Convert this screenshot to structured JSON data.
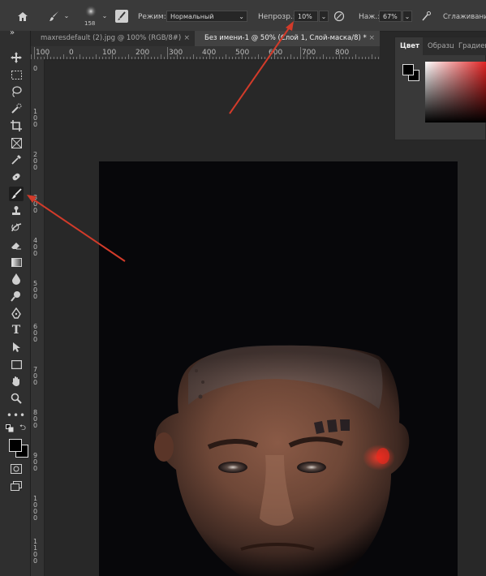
{
  "options_bar": {
    "brush_size": "158",
    "mode_label": "Режим:",
    "mode_value": "Нормальный",
    "opacity_label": "Непрозр.:",
    "opacity_value": "10%",
    "flow_label": "Наж.:",
    "flow_value": "67%",
    "smoothing_label": "Сглаживание",
    "icons": [
      "home-icon",
      "brush-preset-icon",
      "brush-settings-icon",
      "pressure-opacity-icon",
      "airbrush-icon"
    ]
  },
  "tabs": [
    {
      "label": "maxresdefault (2).jpg @ 100% (RGB/8#)",
      "active": false,
      "close": "×"
    },
    {
      "label": "Без имени-1 @ 50% (Слой 1, Слой-маска/8) *",
      "active": true,
      "close": "×"
    }
  ],
  "toolbar": {
    "collapse": "»",
    "tools": [
      "move",
      "marquee",
      "lasso",
      "quick-selection",
      "crop",
      "frame",
      "eyedropper",
      "healing",
      "brush",
      "clone-stamp",
      "history-brush",
      "eraser",
      "gradient",
      "blur",
      "dodge",
      "pen",
      "type",
      "path-selection",
      "rectangle",
      "hand",
      "zoom",
      "more"
    ],
    "active_tool": "brush",
    "foreground_color": "#000000",
    "background_color": "#000000"
  },
  "ruler": {
    "h_labels": [
      "100",
      "0",
      "100",
      "200",
      "300",
      "400",
      "500",
      "600",
      "700",
      "800"
    ],
    "v_labels": [
      "0",
      "100",
      "200",
      "300",
      "400",
      "500",
      "600",
      "700",
      "800",
      "900",
      "1000",
      "1100"
    ]
  },
  "color_panel": {
    "tabs": [
      "Цвет",
      "Образцы",
      "Градиенты"
    ],
    "active_tab": "Цвет",
    "hue_color": "#e02020"
  },
  "annotations": {
    "arrow_color": "#d23b2a",
    "count": 2
  }
}
